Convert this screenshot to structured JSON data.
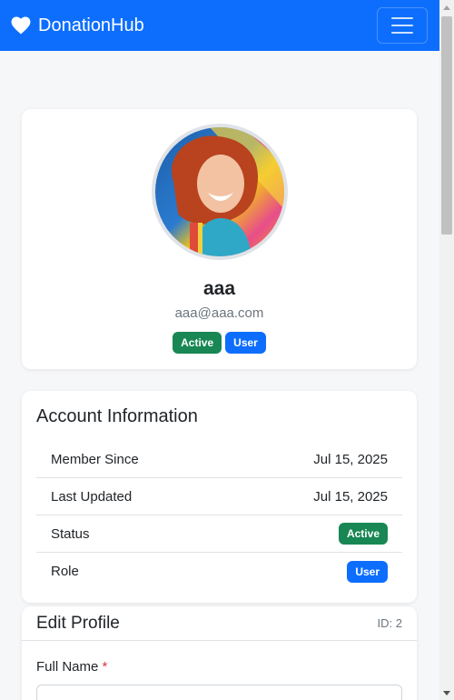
{
  "navbar": {
    "brand": "DonationHub",
    "brand_icon": "heart-icon",
    "menu_icon": "hamburger-menu-icon",
    "color": "#0d6efd"
  },
  "profile": {
    "name": "aaa",
    "email": "aaa@aaa.com",
    "status_badge": "Active",
    "role_badge": "User"
  },
  "account": {
    "title": "Account Information",
    "rows": [
      {
        "label": "Member Since",
        "value": "Jul 15, 2025"
      },
      {
        "label": "Last Updated",
        "value": "Jul 15, 2025"
      },
      {
        "label": "Status",
        "value": "Active"
      },
      {
        "label": "Role",
        "value": "User"
      }
    ]
  },
  "edit_profile": {
    "title": "Edit Profile",
    "id_label": "ID: 2",
    "full_name_label": "Full Name",
    "required_mark": "*",
    "full_name_value": ""
  },
  "colors": {
    "success": "#198754",
    "primary": "#0d6efd",
    "danger": "#dc3545"
  }
}
